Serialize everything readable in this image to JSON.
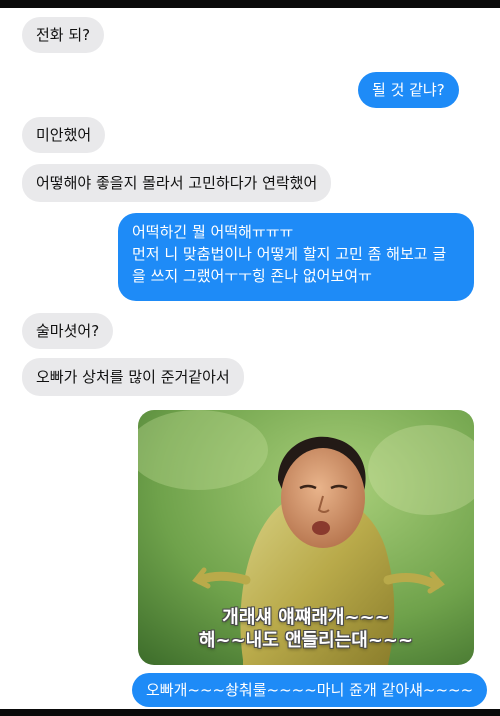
{
  "messages": [
    {
      "dir": "in",
      "text": "전화 되?"
    },
    {
      "dir": "out",
      "text": "될 것 같냐?"
    },
    {
      "dir": "in",
      "text": "미안했어"
    },
    {
      "dir": "in",
      "text": "어떻해야 좋을지 몰라서 고민하다가 연락했어"
    },
    {
      "dir": "out",
      "lines": [
        "어떡하긴 뭘 어떡해ㅠㅠㅠ",
        "먼저 니 맞춤법이나 어떻게 할지 고민 좀 해보고 글",
        "을 쓰지 그랬어ㅜㅜ힝 죤나 없어보여ㅠ"
      ]
    },
    {
      "dir": "in",
      "text": "술마셧어?"
    },
    {
      "dir": "in",
      "text": "오빠가 상처를 많이 준거같아서"
    },
    {
      "dir": "out",
      "text": "오빠개~~~솽춰룰~~~~마니 쥰개 같아섀~~~~"
    }
  ],
  "meme": {
    "caption_line1": "개래섀 얘쨰래개~~~",
    "caption_line2": "해~~내도 앤들리는대~~~"
  },
  "colors": {
    "incoming_bubble": "#e9e9eb",
    "outgoing_bubble": "#1e8bf7"
  }
}
